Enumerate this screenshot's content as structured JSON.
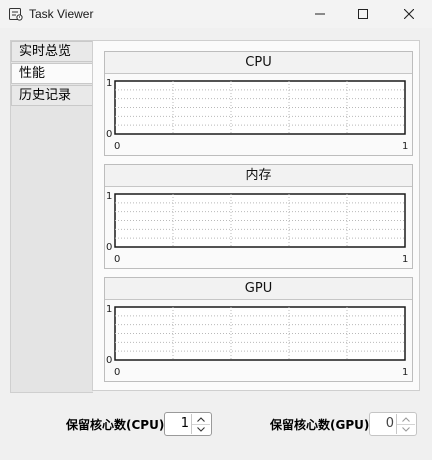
{
  "window": {
    "title": "Task Viewer",
    "icon": "task-viewer-app-icon",
    "controls": [
      "minimize-icon",
      "maximize-icon",
      "close-icon"
    ]
  },
  "tabs": [
    {
      "label": "实时总览",
      "active": false
    },
    {
      "label": "性能",
      "active": true
    },
    {
      "label": "历史记录",
      "active": false
    }
  ],
  "charts": [
    {
      "title": "CPU",
      "y_top": "1",
      "y_bottom": "0",
      "x_left": "0",
      "x_right": "1"
    },
    {
      "title": "内存",
      "y_top": "1",
      "y_bottom": "0",
      "x_left": "0",
      "x_right": "1"
    },
    {
      "title": "GPU",
      "y_top": "1",
      "y_bottom": "0",
      "x_left": "0",
      "x_right": "1"
    }
  ],
  "controls": {
    "cpu_reserve": {
      "label": "保留核心数(CPU)",
      "value": "1",
      "enabled": true
    },
    "gpu_reserve": {
      "label": "保留核心数(GPU)",
      "value": "0",
      "enabled": false
    }
  },
  "colors": {
    "background": "#f0f0f0",
    "panel": "#fbfbfb",
    "plot_frame": "#1a1a1a",
    "grid": "#b9b9b9"
  }
}
